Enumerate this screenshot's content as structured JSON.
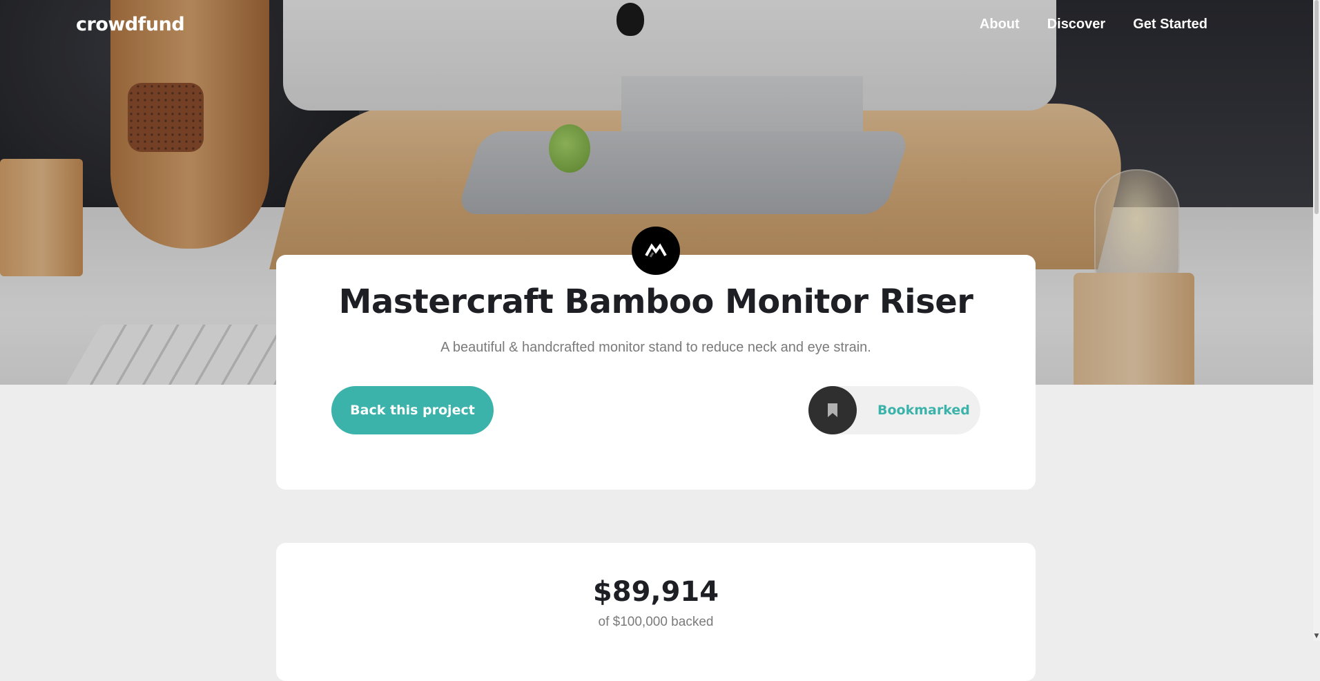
{
  "brand": {
    "logo": "crowdfund"
  },
  "nav": {
    "items": [
      "About",
      "Discover",
      "Get Started"
    ]
  },
  "project": {
    "logo_icon": "mastercraft-logo-icon",
    "title": "Mastercraft Bamboo Monitor Riser",
    "description": "A beautiful & handcrafted monitor stand to reduce neck and eye strain.",
    "back_button": "Back this project",
    "bookmark_button": "Bookmarked",
    "bookmark_icon": "bookmark-icon"
  },
  "stats": {
    "amount_backed": "$89,914",
    "goal_text": "of $100,000 backed"
  },
  "colors": {
    "accent": "#3cb3aa",
    "dark": "#2f2f2f",
    "background": "#ededed",
    "card": "#ffffff"
  }
}
